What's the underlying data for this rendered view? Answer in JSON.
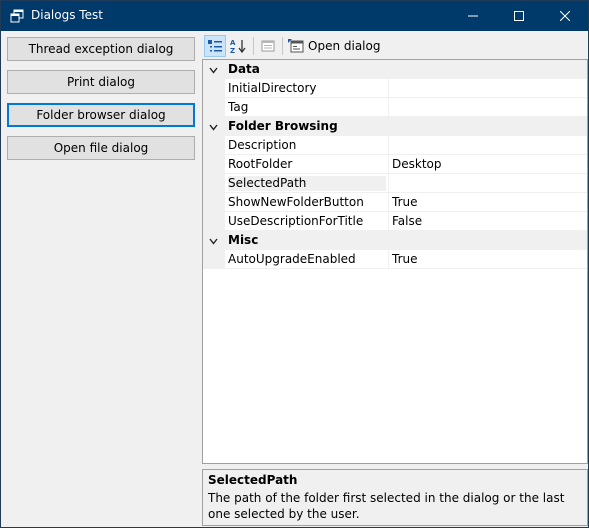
{
  "window": {
    "title": "Dialogs Test"
  },
  "left_buttons": [
    {
      "label": "Thread exception dialog"
    },
    {
      "label": "Print dialog"
    },
    {
      "label": "Folder browser dialog"
    },
    {
      "label": "Open file dialog"
    }
  ],
  "toolbar": {
    "open_dialog_label": "Open dialog"
  },
  "grid": {
    "categories": [
      {
        "name": "Data",
        "rows": [
          {
            "name": "InitialDirectory",
            "value": ""
          },
          {
            "name": "Tag",
            "value": ""
          }
        ]
      },
      {
        "name": "Folder Browsing",
        "rows": [
          {
            "name": "Description",
            "value": ""
          },
          {
            "name": "RootFolder",
            "value": "Desktop"
          },
          {
            "name": "SelectedPath",
            "value": ""
          },
          {
            "name": "ShowNewFolderButton",
            "value": "True"
          },
          {
            "name": "UseDescriptionForTitle",
            "value": "False"
          }
        ]
      },
      {
        "name": "Misc",
        "rows": [
          {
            "name": "AutoUpgradeEnabled",
            "value": "True"
          }
        ]
      }
    ]
  },
  "help": {
    "title": "SelectedPath",
    "description": "The path of the folder first selected in the dialog or the last one selected by the user."
  },
  "colors": {
    "titlebar": "#003a6b",
    "focus_border": "#0078d7"
  }
}
